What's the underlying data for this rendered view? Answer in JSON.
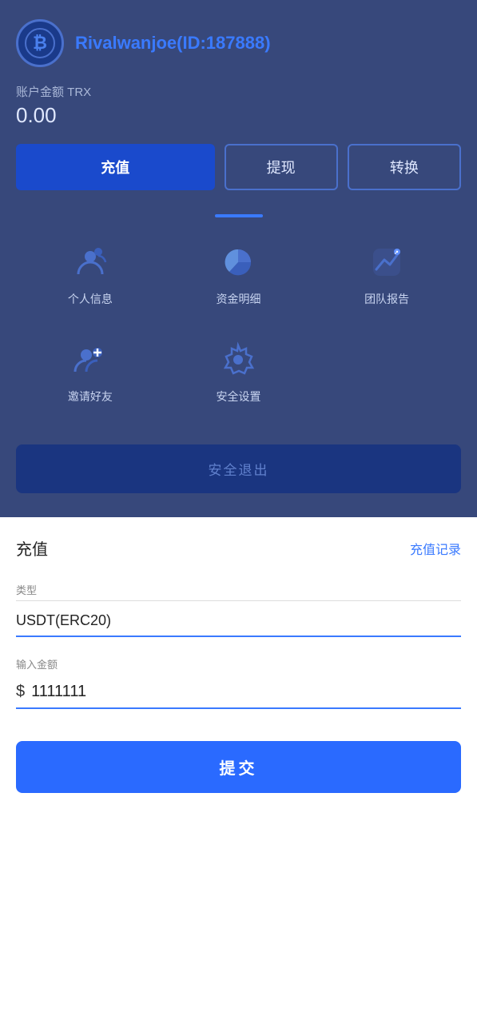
{
  "profile": {
    "username": "Rivalwanjoe(ID:187888)",
    "account_label": "账户金额 TRX",
    "balance": "0.00"
  },
  "buttons": {
    "recharge": "充值",
    "withdraw": "提现",
    "convert": "转换",
    "logout": "安全退出",
    "submit": "提交"
  },
  "menu": {
    "items_row1": [
      {
        "label": "个人信息",
        "icon": "person-icon"
      },
      {
        "label": "资金明细",
        "icon": "chart-icon"
      },
      {
        "label": "团队报告",
        "icon": "trend-icon"
      }
    ],
    "items_row2": [
      {
        "label": "邀请好友",
        "icon": "invite-icon"
      },
      {
        "label": "安全设置",
        "icon": "settings-icon"
      }
    ]
  },
  "bottom": {
    "title": "充值",
    "history_link": "充值记录",
    "type_label": "类型",
    "type_value": "USDT(ERC20)",
    "amount_label": "输入金额",
    "amount_value": "1111111",
    "currency_symbol": "$"
  }
}
